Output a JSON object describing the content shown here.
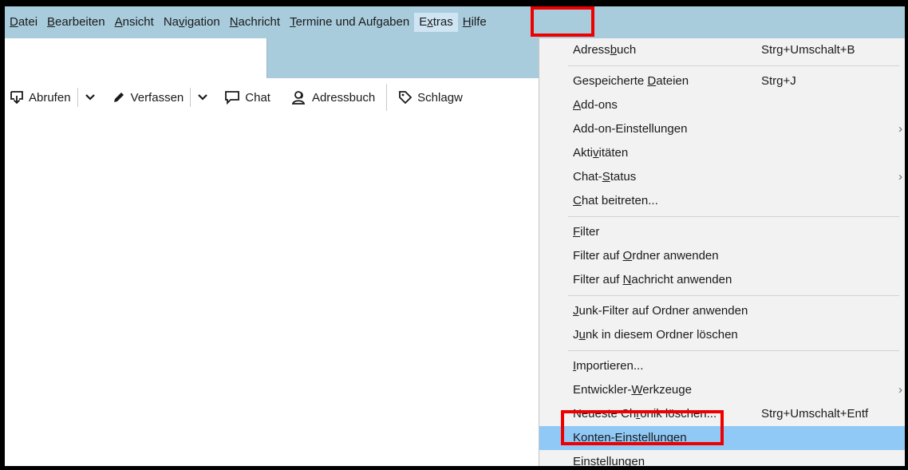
{
  "menubar": {
    "items": [
      {
        "name": "menu-datei",
        "pre": "",
        "key": "D",
        "post": "atei"
      },
      {
        "name": "menu-bearbeiten",
        "pre": "",
        "key": "B",
        "post": "earbeiten"
      },
      {
        "name": "menu-ansicht",
        "pre": "",
        "key": "A",
        "post": "nsicht"
      },
      {
        "name": "menu-navigation",
        "pre": "Na",
        "key": "v",
        "post": "igation"
      },
      {
        "name": "menu-nachricht",
        "pre": "",
        "key": "N",
        "post": "achricht"
      },
      {
        "name": "menu-termine",
        "pre": "",
        "key": "T",
        "post": "ermine und Aufgaben"
      },
      {
        "name": "menu-extras",
        "pre": "E",
        "key": "x",
        "post": "tras"
      },
      {
        "name": "menu-hilfe",
        "pre": "",
        "key": "H",
        "post": "ilfe"
      }
    ]
  },
  "toolbar": {
    "abrufen": "Abrufen",
    "verfassen": "Verfassen",
    "chat": "Chat",
    "adressbuch": "Adressbuch",
    "schlagwoerter": "Schlagw"
  },
  "extras_menu": {
    "groups": [
      [
        {
          "pre": "Adress",
          "key": "b",
          "post": "uch",
          "shortcut": "Strg+Umschalt+B",
          "submenu": false
        }
      ],
      [
        {
          "pre": "Gespeicherte ",
          "key": "D",
          "post": "ateien",
          "shortcut": "Strg+J",
          "submenu": false
        },
        {
          "pre": "",
          "key": "A",
          "post": "dd-ons",
          "shortcut": "",
          "submenu": false
        },
        {
          "pre": "Add-on-Einstellun",
          "key": "g",
          "post": "en",
          "shortcut": "",
          "submenu": true
        },
        {
          "pre": "Akti",
          "key": "v",
          "post": "itäten",
          "shortcut": "",
          "submenu": false
        },
        {
          "pre": "Chat-",
          "key": "S",
          "post": "tatus",
          "shortcut": "",
          "submenu": true
        },
        {
          "pre": "",
          "key": "C",
          "post": "hat beitreten...",
          "shortcut": "",
          "submenu": false
        }
      ],
      [
        {
          "pre": "",
          "key": "F",
          "post": "ilter",
          "shortcut": "",
          "submenu": false
        },
        {
          "pre": "Filter auf ",
          "key": "O",
          "post": "rdner anwenden",
          "shortcut": "",
          "submenu": false
        },
        {
          "pre": "Filter auf ",
          "key": "N",
          "post": "achricht anwenden",
          "shortcut": "",
          "submenu": false
        }
      ],
      [
        {
          "pre": "",
          "key": "J",
          "post": "unk-Filter auf Ordner anwenden",
          "shortcut": "",
          "submenu": false
        },
        {
          "pre": "J",
          "key": "u",
          "post": "nk in diesem Ordner löschen",
          "shortcut": "",
          "submenu": false
        }
      ],
      [
        {
          "pre": "",
          "key": "I",
          "post": "mportieren...",
          "shortcut": "",
          "submenu": false
        },
        {
          "pre": "Entwickler-",
          "key": "W",
          "post": "erkzeuge",
          "shortcut": "",
          "submenu": true
        },
        {
          "pre": "Neueste Ch",
          "key": "r",
          "post": "onik löschen...",
          "shortcut": "Strg+Umschalt+Entf",
          "submenu": false
        },
        {
          "pre": "",
          "key": "K",
          "post": "onten-Einstellungen",
          "shortcut": "",
          "submenu": false,
          "highlighted": true
        },
        {
          "pre": "",
          "key": "E",
          "post": "instellungen",
          "shortcut": "",
          "submenu": false
        }
      ]
    ],
    "arrow_glyph": "›"
  },
  "colors": {
    "menubar_bg": "#a9ccdd",
    "menu_bg": "#f2f2f2",
    "highlight": "#90c8f6",
    "annotation_red": "#ee0000"
  }
}
